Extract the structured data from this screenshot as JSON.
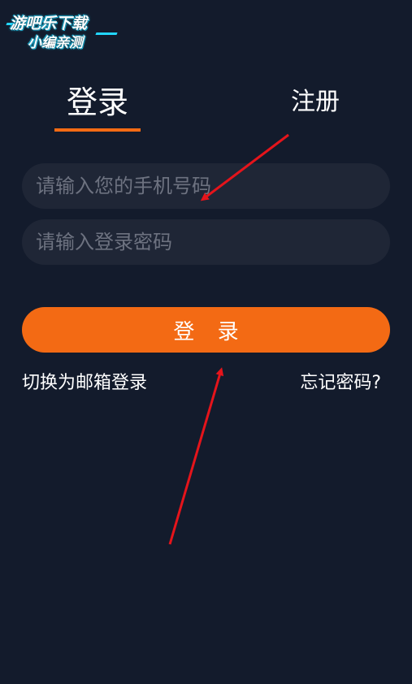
{
  "watermark": {
    "line1": "游吧乐下载",
    "line2": "小编亲测"
  },
  "tabs": {
    "login_label": "登录",
    "register_label": "注册"
  },
  "form": {
    "phone_placeholder": "请输入您的手机号码",
    "password_placeholder": "请输入登录密码",
    "submit_label": "登 录"
  },
  "links": {
    "email_login": "切换为邮箱登录",
    "forgot_password": "忘记密码?"
  },
  "colors": {
    "background": "#131b2c",
    "accent": "#f36a14",
    "input_background": "#1f2636",
    "placeholder": "#6d7280",
    "annotation_arrow": "#e5141b"
  }
}
